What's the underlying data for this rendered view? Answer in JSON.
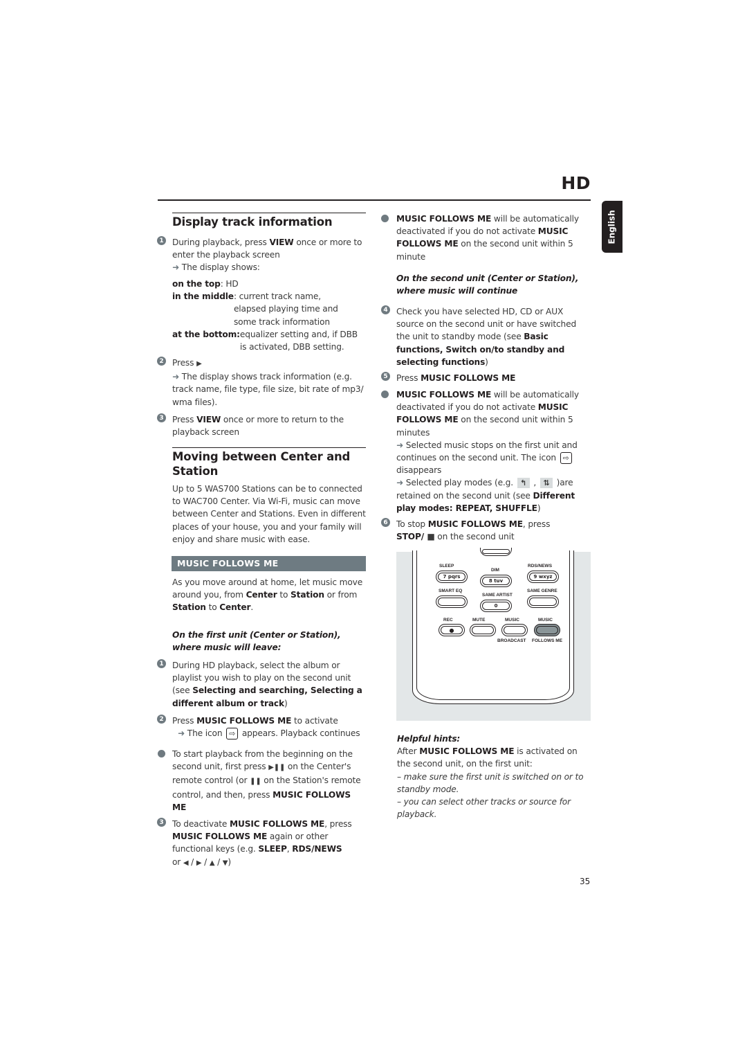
{
  "header": {
    "section_code": "HD",
    "language_tab": "English"
  },
  "left_column": {
    "display_track": {
      "title": "Display track information",
      "steps": [
        {
          "num": "1",
          "text_parts": [
            "During playback, press ",
            "VIEW",
            " once or more to enter the playback screen"
          ],
          "result": "The display shows:"
        },
        {
          "num": "2",
          "text": "Press",
          "icon": "play-icon",
          "result": "The display shows track information (e.g. track name, file type, file size, bit rate of mp3/ wma files)."
        },
        {
          "num": "3",
          "text_parts": [
            "Press ",
            "VIEW",
            " once or more to return to the playback screen"
          ]
        }
      ],
      "display_rows": [
        {
          "label": "on the top",
          "value": ": HD"
        },
        {
          "label": "in the middle",
          "value": ": current track name, elapsed playing time and some track information"
        },
        {
          "label": "at the bottom:",
          "value": " equalizer setting and, if DBB is activated, DBB setting."
        }
      ]
    },
    "moving": {
      "title_line1": "Moving between Center and",
      "title_line2": "Station",
      "body": "Up to 5 WAS700 Stations can be to connected to WAC700 Center. Via Wi-Fi,  music can move between Center and Stations. Even in different places of your house, you and your family will enjoy and share music with ease."
    },
    "music_follows_me": {
      "bar_title": "MUSIC FOLLOWS ME",
      "intro_parts": [
        "As you move around at home, let music move around you, from ",
        "Center",
        " to ",
        "Station",
        "  or from ",
        "Station",
        " to ",
        "Center",
        "."
      ],
      "first_unit_heading": "On the first unit (Center or Station), where music will leave:",
      "steps": [
        {
          "num": "1",
          "text": "During HD playback, select the album or playlist you wish to play on the second unit (see ",
          "bold": "Selecting and searching, Selecting a different album or track",
          "after": ")"
        },
        {
          "num": "2",
          "text": "Press ",
          "bold": "MUSIC FOLLOWS ME",
          "after": " to activate",
          "result_before": "The icon ",
          "result_icon": "music-follows-me-icon",
          "result_after": " appears. Playback continues"
        }
      ],
      "bullet_start": {
        "t1": "To start playback from the beginning on the second unit,  first press ",
        "t2": " on the Center's remote control (or ",
        "t3": " on the Station's remote control, and then, press ",
        "bold": "MUSIC FOLLOWS ME"
      },
      "step3": {
        "num": "3",
        "t1": "To deactivate ",
        "b1": "MUSIC FOLLOWS ME",
        "t2": ", press ",
        "b2": "MUSIC FOLLOWS ME",
        "t3": " again or other functional keys (e.g. ",
        "b3": "SLEEP",
        "t4": ", ",
        "b4": "RDS/NEWS",
        "t5": " or ",
        "keys": [
          "◀",
          "▶",
          "▲",
          "▼"
        ],
        "t6": ")"
      }
    }
  },
  "right_column": {
    "bullet_auto1": {
      "b1": "MUSIC FOLLOWS ME",
      "t1": " will be automatically deactivated if you do not activate ",
      "b2": "MUSIC FOLLOWS ME",
      "t2": " on the second unit within 5 minute"
    },
    "second_unit_heading": "On the second unit (Center or Station), where music will continue",
    "step4": {
      "num": "4",
      "t1": "Check you have selected HD, CD or AUX source on the second unit or have switched the unit to standby mode (see ",
      "b1": "Basic functions, Switch on/to standby and selecting functions",
      "t2": ")"
    },
    "step5": {
      "num": "5",
      "t1": "Press ",
      "b1": "MUSIC FOLLOWS ME"
    },
    "bullet_auto2": {
      "b1": "MUSIC FOLLOWS ME",
      "t1": " will be automatically deactivated if you do not activate ",
      "b2": "MUSIC FOLLOWS ME",
      "t2": " on the second unit within 5 minutes",
      "r1_before": "Selected music stops on the first unit and continues on the second unit.  The icon ",
      "r1_after": " disappears",
      "r2_before": "Selected play modes (e.g. ",
      "r2_mid": " , ",
      "r2_after": " )are retained on the second unit (see ",
      "r2_bold": "Different play modes: REPEAT, SHUFFLE",
      "r2_end": ")"
    },
    "step6": {
      "num": "6",
      "t1": "To stop ",
      "b1": "MUSIC FOLLOWS ME",
      "t2": ", press ",
      "b2": "STOP/ ",
      "stop_glyph": "■",
      "t3": " on the second unit"
    },
    "remote": {
      "labels": {
        "sleep": "SLEEP",
        "dim": "DIM",
        "rds_news": "RDS/NEWS",
        "smart_eq": "SMART EQ",
        "same_artist": "SAME ARTIST",
        "same_genre": "SAME GENRE",
        "rec": "REC",
        "mute": "MUTE",
        "music_broadcast_top": "MUSIC",
        "music_broadcast_bottom": "BROADCAST",
        "music_follows_top": "MUSIC",
        "music_follows_bottom": "FOLLOWS ME"
      },
      "keys": {
        "k7": "7  pqrs",
        "k8": "8  tuv",
        "k9": "9  wxyz",
        "k0": "0",
        "rec_dot": "●"
      },
      "highlight_color": "#8a9598"
    },
    "hints": {
      "title": "Helpful hints:",
      "t1": "After ",
      "b1": "MUSIC FOLLOWS ME",
      "t2": " is activated on the second unit,  on the first unit:",
      "items": [
        "–  make sure the first unit is switched on or to standby mode.",
        "– you can select other tracks or source for playback."
      ]
    }
  },
  "footer": {
    "page_number": "35"
  },
  "glyphs": {
    "arrow": "➜",
    "play": "▶",
    "play_pause": "▶❚❚",
    "pause": "❚❚",
    "mfm_icon": "⇨",
    "repeat_icon": "↰",
    "shuffle_icon": "⇅"
  }
}
